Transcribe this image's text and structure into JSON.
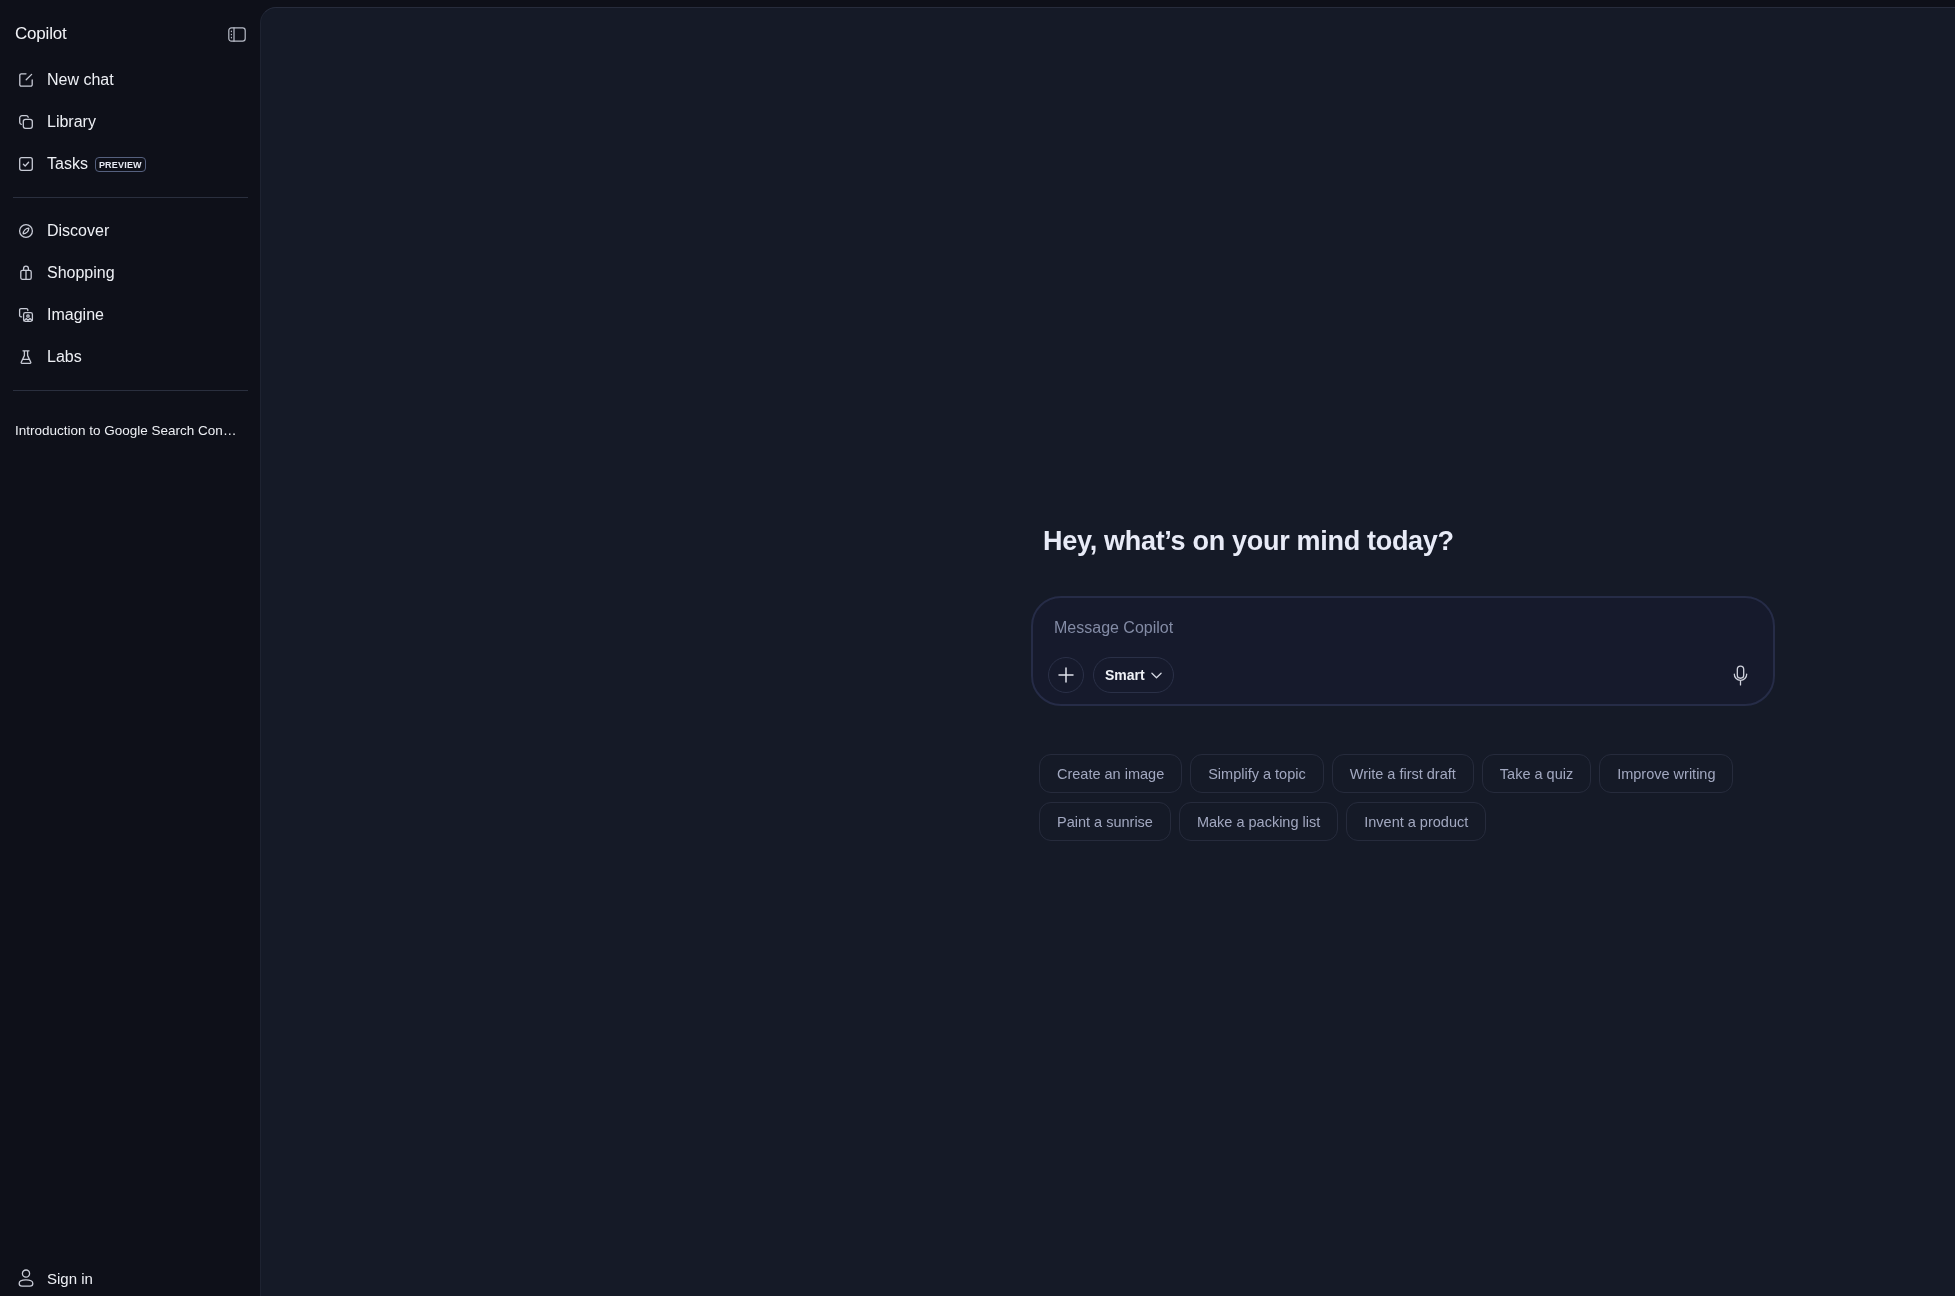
{
  "sidebar": {
    "title": "Copilot",
    "nav_groups": [
      [
        {
          "label": "New chat"
        },
        {
          "label": "Library"
        },
        {
          "label": "Tasks",
          "badge": "PREVIEW"
        }
      ],
      [
        {
          "label": "Discover"
        },
        {
          "label": "Shopping"
        },
        {
          "label": "Imagine"
        },
        {
          "label": "Labs"
        }
      ]
    ],
    "recent_chats": [
      "Introduction to Google Search Con…"
    ],
    "sign_in": "Sign in"
  },
  "main": {
    "heading": "Hey, what’s on your mind today?",
    "composer": {
      "placeholder": "Message Copilot",
      "mode": "Smart"
    },
    "suggestion_rows": [
      [
        "Create an image",
        "Simplify a topic",
        "Write a first draft",
        "Take a quiz",
        "Improve writing"
      ],
      [
        "Paint a sunrise",
        "Make a packing list",
        "Invent a product"
      ]
    ]
  }
}
